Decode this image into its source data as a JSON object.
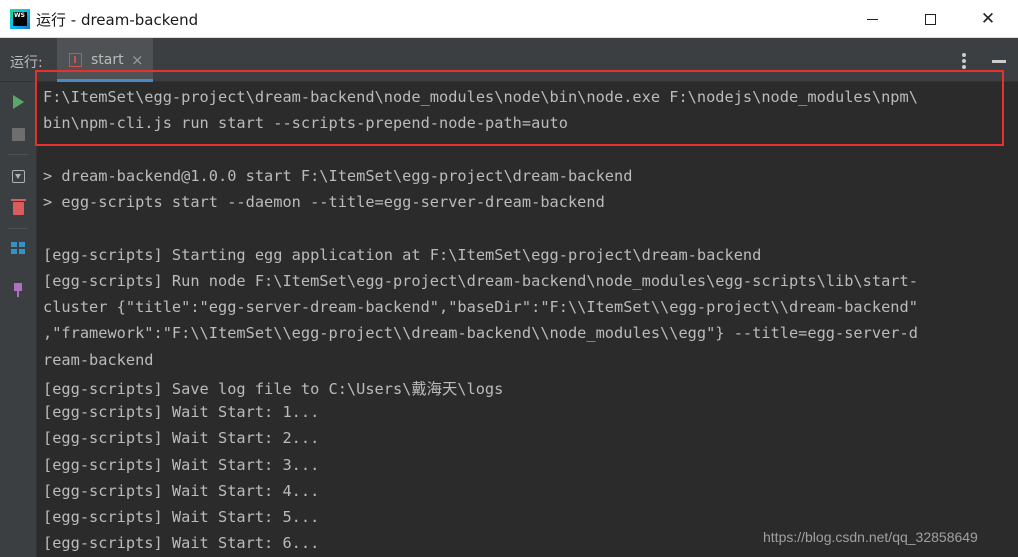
{
  "window": {
    "icon_text": "WS",
    "title": "运行 - dream-backend",
    "controls": {
      "minimize_icon": "minimize-icon",
      "maximize_icon": "maximize-icon",
      "close_icon": "close-icon",
      "close_glyph": "✕"
    }
  },
  "run_panel": {
    "label": "运行:",
    "tab": {
      "label": "start",
      "close_glyph": "×"
    }
  },
  "toolbar": {
    "icons": [
      "rerun-icon",
      "stop-icon",
      "scroll-to-end-icon",
      "clear-icon",
      "layout-icon",
      "pin-icon"
    ]
  },
  "console": {
    "lines": [
      "F:\\ItemSet\\egg-project\\dream-backend\\node_modules\\node\\bin\\node.exe F:\\nodejs\\node_modules\\npm\\",
      "bin\\npm-cli.js run start --scripts-prepend-node-path=auto",
      "> dream-backend@1.0.0 start F:\\ItemSet\\egg-project\\dream-backend",
      "> egg-scripts start --daemon --title=egg-server-dream-backend",
      "[egg-scripts] Starting egg application at F:\\ItemSet\\egg-project\\dream-backend",
      "[egg-scripts] Run node F:\\ItemSet\\egg-project\\dream-backend\\node_modules\\egg-scripts\\lib\\start-",
      "cluster {\"title\":\"egg-server-dream-backend\",\"baseDir\":\"F:\\\\ItemSet\\\\egg-project\\\\dream-backend\"",
      ",\"framework\":\"F:\\\\ItemSet\\\\egg-project\\\\dream-backend\\\\node_modules\\\\egg\"} --title=egg-server-d",
      "ream-backend",
      "[egg-scripts] Save log file to C:\\Users\\戴海天\\logs",
      "[egg-scripts] Wait Start: 1...",
      "[egg-scripts] Wait Start: 2...",
      "[egg-scripts] Wait Start: 3...",
      "[egg-scripts] Wait Start: 4...",
      "[egg-scripts] Wait Start: 5...",
      "[egg-scripts] Wait Start: 6..."
    ]
  },
  "watermark": "https://blog.csdn.net/qq_32858649",
  "colors": {
    "console_bg": "#2b2b2b",
    "console_text": "#bbbbbb",
    "highlight_border": "#e8312c",
    "tab_underline": "#4a88c7",
    "rerun_green": "#59a869"
  }
}
